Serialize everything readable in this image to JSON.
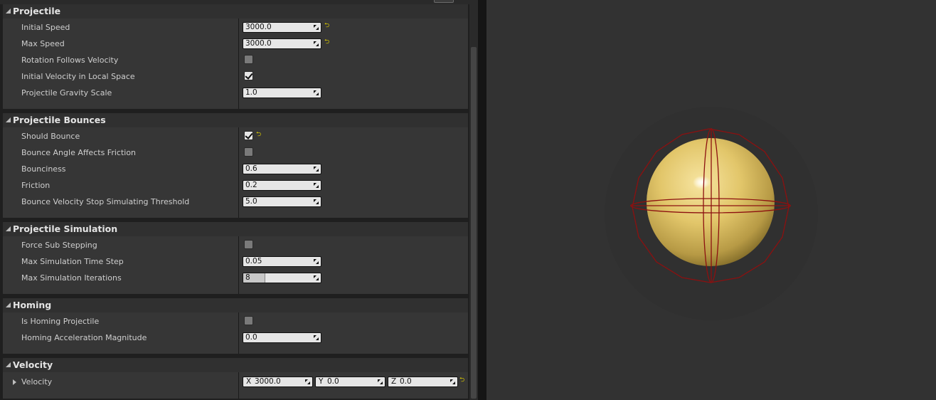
{
  "categories": [
    {
      "title": "Projectile",
      "rows": [
        {
          "label": "Initial Speed",
          "value": "3000.0"
        },
        {
          "label": "Max Speed",
          "value": "3000.0"
        },
        {
          "label": "Rotation Follows Velocity"
        },
        {
          "label": "Initial Velocity in Local Space"
        },
        {
          "label": "Projectile Gravity Scale",
          "value": "1.0"
        }
      ]
    },
    {
      "title": "Projectile Bounces",
      "rows": [
        {
          "label": "Should Bounce"
        },
        {
          "label": "Bounce Angle Affects Friction"
        },
        {
          "label": "Bounciness",
          "value": "0.6"
        },
        {
          "label": "Friction",
          "value": "0.2"
        },
        {
          "label": "Bounce Velocity Stop Simulating Threshold",
          "value": "5.0"
        }
      ]
    },
    {
      "title": "Projectile Simulation",
      "rows": [
        {
          "label": "Force Sub Stepping"
        },
        {
          "label": "Max Simulation Time Step",
          "value": "0.05"
        },
        {
          "label": "Max Simulation Iterations",
          "value": "8"
        }
      ]
    },
    {
      "title": "Homing",
      "rows": [
        {
          "label": "Is Homing Projectile"
        },
        {
          "label": "Homing Acceleration Magnitude",
          "value": "0.0"
        }
      ]
    },
    {
      "title": "Velocity",
      "rows": [
        {
          "label": "Velocity",
          "x_axis": "X",
          "x": "3000.0",
          "y_axis": "Y",
          "y": "0.0",
          "z_axis": "Z",
          "z": "0.0"
        }
      ]
    }
  ],
  "checkboxes": {
    "rotation_follows_velocity": false,
    "initial_velocity_in_local_space": true,
    "should_bounce": true,
    "bounce_angle_affects_friction": false,
    "force_sub_stepping": false,
    "is_homing_projectile": false
  },
  "colors": {
    "sphere": "#e2c66a",
    "collision_wire": "#8c1010",
    "reset_arrow": "#d8c800"
  },
  "icons": [
    "reset-to-default-icon",
    "drag-handle-icon",
    "category-collapse-arrow-icon",
    "expand-arrow-icon",
    "checkmark-icon"
  ]
}
